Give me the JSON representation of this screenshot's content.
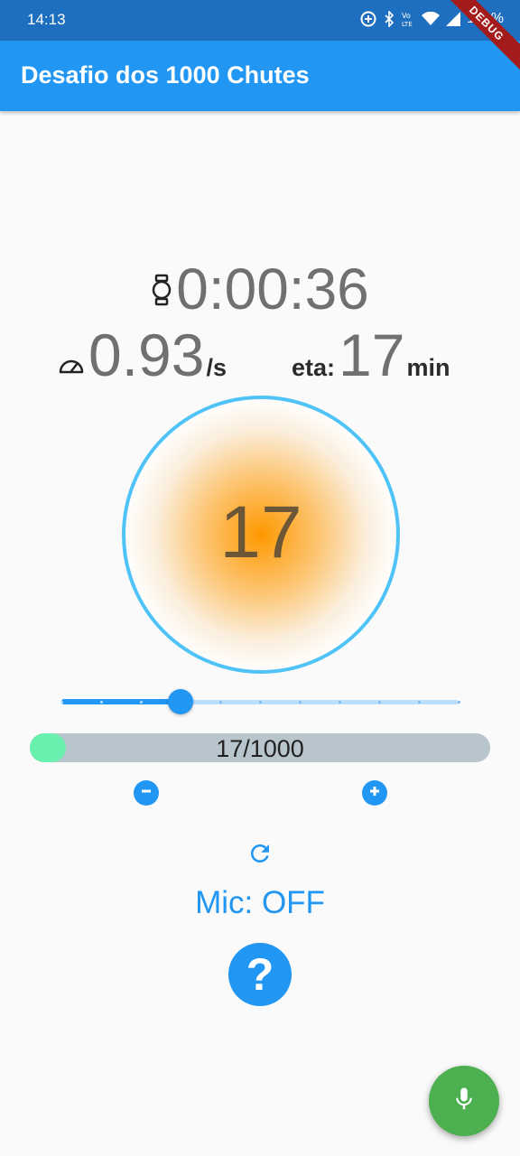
{
  "status_bar": {
    "time": "14:13",
    "battery": "100%",
    "icons": [
      "data-saver-icon",
      "bluetooth-icon",
      "volte-icon",
      "wifi-icon",
      "signal-icon",
      "battery-icon"
    ]
  },
  "debug_banner": "DEBUG",
  "app_bar": {
    "title": "Desafio dos 1000 Chutes"
  },
  "timer": {
    "icon": "stopwatch-icon",
    "value": "0:00:36"
  },
  "speed": {
    "icon": "speedometer-icon",
    "value": "0.93",
    "unit": "/s"
  },
  "eta": {
    "label": "eta:",
    "value": "17",
    "unit": "min"
  },
  "counter": {
    "count": "17"
  },
  "slider": {
    "value_fraction": 0.3,
    "divisions": 10
  },
  "progress": {
    "label": "17/1000",
    "current": 17,
    "total": 1000
  },
  "controls": {
    "decrement_icon": "minus-icon",
    "increment_icon": "plus-icon",
    "reset_icon": "refresh-icon"
  },
  "mic": {
    "status": "Mic: OFF"
  },
  "help": {
    "label": "?"
  },
  "fab": {
    "icon": "mic-icon"
  },
  "colors": {
    "primary": "#2196f3",
    "status_bar": "#1e6fbf",
    "circle_border": "#4fc3f7",
    "circle_glow": "#ff9800",
    "progress_fill": "#69f0ae",
    "progress_track": "#b8c5cc",
    "fab": "#4caf50"
  }
}
